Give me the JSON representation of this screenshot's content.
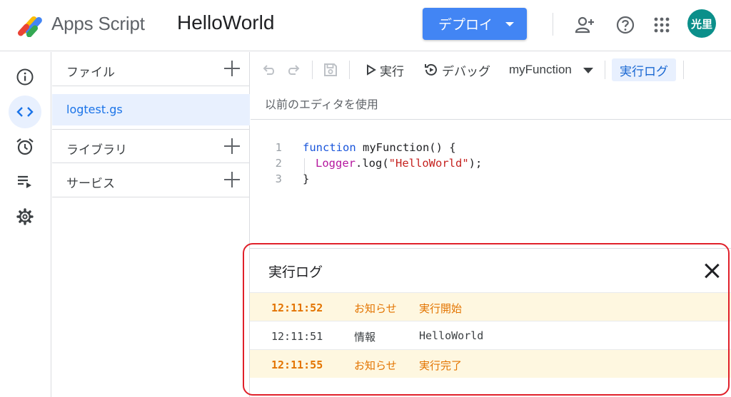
{
  "header": {
    "app_name": "Apps Script",
    "project_name": "HelloWorld",
    "deploy_label": "デプロイ",
    "avatar_initials": "光里"
  },
  "files_panel": {
    "files_title": "ファイル",
    "active_file": "logtest.gs",
    "libraries_title": "ライブラリ",
    "services_title": "サービス"
  },
  "toolbar": {
    "run_label": "実行",
    "debug_label": "デバッグ",
    "function_select": "myFunction",
    "log_toggle_label": "実行ログ",
    "legacy_editor_link": "以前のエディタを使用"
  },
  "code": {
    "lines": [
      {
        "number": "1",
        "keyword": "function",
        "rest": " myFunction() {"
      },
      {
        "number": "2",
        "object": "Logger",
        "call": ".log(",
        "string": "\"HelloWorld\"",
        "tail": ");"
      },
      {
        "number": "3",
        "text": "}"
      }
    ]
  },
  "log_panel": {
    "title": "実行ログ",
    "rows": [
      {
        "time": "12:11:52",
        "level": "お知らせ",
        "message": "実行開始"
      },
      {
        "time": "12:11:51",
        "level": "情報",
        "message": "HelloWorld"
      },
      {
        "time": "12:11:55",
        "level": "お知らせ",
        "message": "実行完了"
      }
    ]
  },
  "colors": {
    "accent": "#4285f4",
    "avatar": "#0b8f8a",
    "notice_text": "#e37400",
    "notice_bg": "#fef7e0",
    "highlight_frame": "#e0202a"
  },
  "icons": {
    "logo": "apps-script-logo",
    "add_person": "person-add-icon",
    "help": "help-icon",
    "apps": "apps-grid-icon",
    "rail": [
      "info-icon",
      "code-icon",
      "alarm-icon",
      "executions-icon",
      "gear-icon"
    ],
    "toolbar": [
      "undo-icon",
      "redo-icon",
      "save-icon",
      "play-icon",
      "debug-icon"
    ]
  }
}
